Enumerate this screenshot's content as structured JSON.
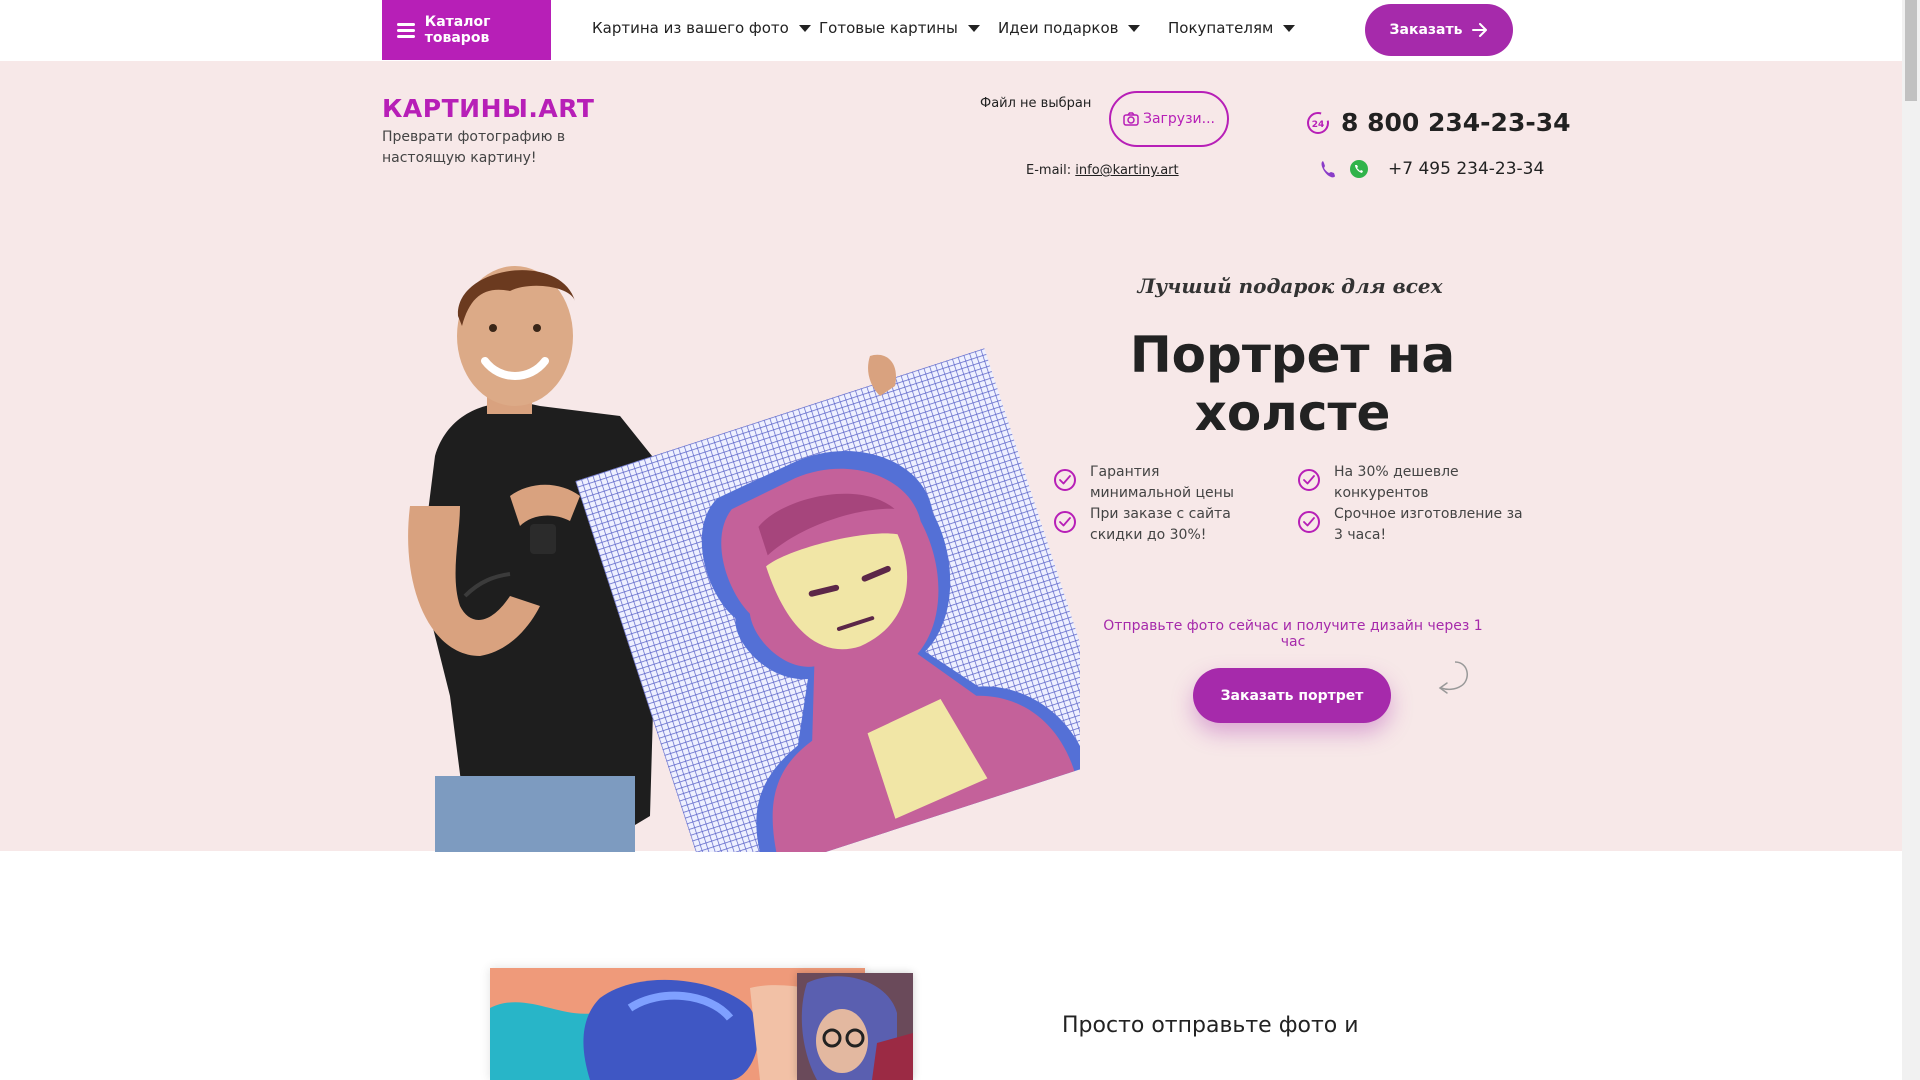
{
  "nav": {
    "catalog_label": "Каталог товаров",
    "items": [
      {
        "label": "Картина из вашего фото"
      },
      {
        "label": "Готовые картины"
      },
      {
        "label": "Идеи подарков"
      },
      {
        "label": "Покупателям"
      }
    ],
    "order_label": "Заказать"
  },
  "header": {
    "logo": "КАРТИНЫ.ART",
    "tagline": "Преврати фотографию в настоящую картину!",
    "file_status": "Файл не выбран",
    "upload_label": "Загрузи...",
    "email_label": "E-mail:",
    "email": "info@kartiny.art",
    "phone_main": "8 800 234-23-34",
    "phone_alt": "+7 495 234-23-34"
  },
  "hero": {
    "subtitle": "Лучший подарок для всех",
    "title": "Портрет на холсте",
    "features": [
      "Гарантия минимальной цены",
      "На 30% дешевле конкурентов",
      "При заказе с сайта скидки до 30%!",
      "Срочное изготовление за 3 часа!"
    ],
    "cta_text": "Отправьте фото сейчас и получите дизайн через 1 час",
    "cta_button": "Заказать портрет"
  },
  "section2": {
    "title": "Просто отправьте фото и"
  },
  "colors": {
    "accent": "#b71fb7",
    "button": "#a62aab",
    "hero_bg": "#f7e8e8"
  }
}
